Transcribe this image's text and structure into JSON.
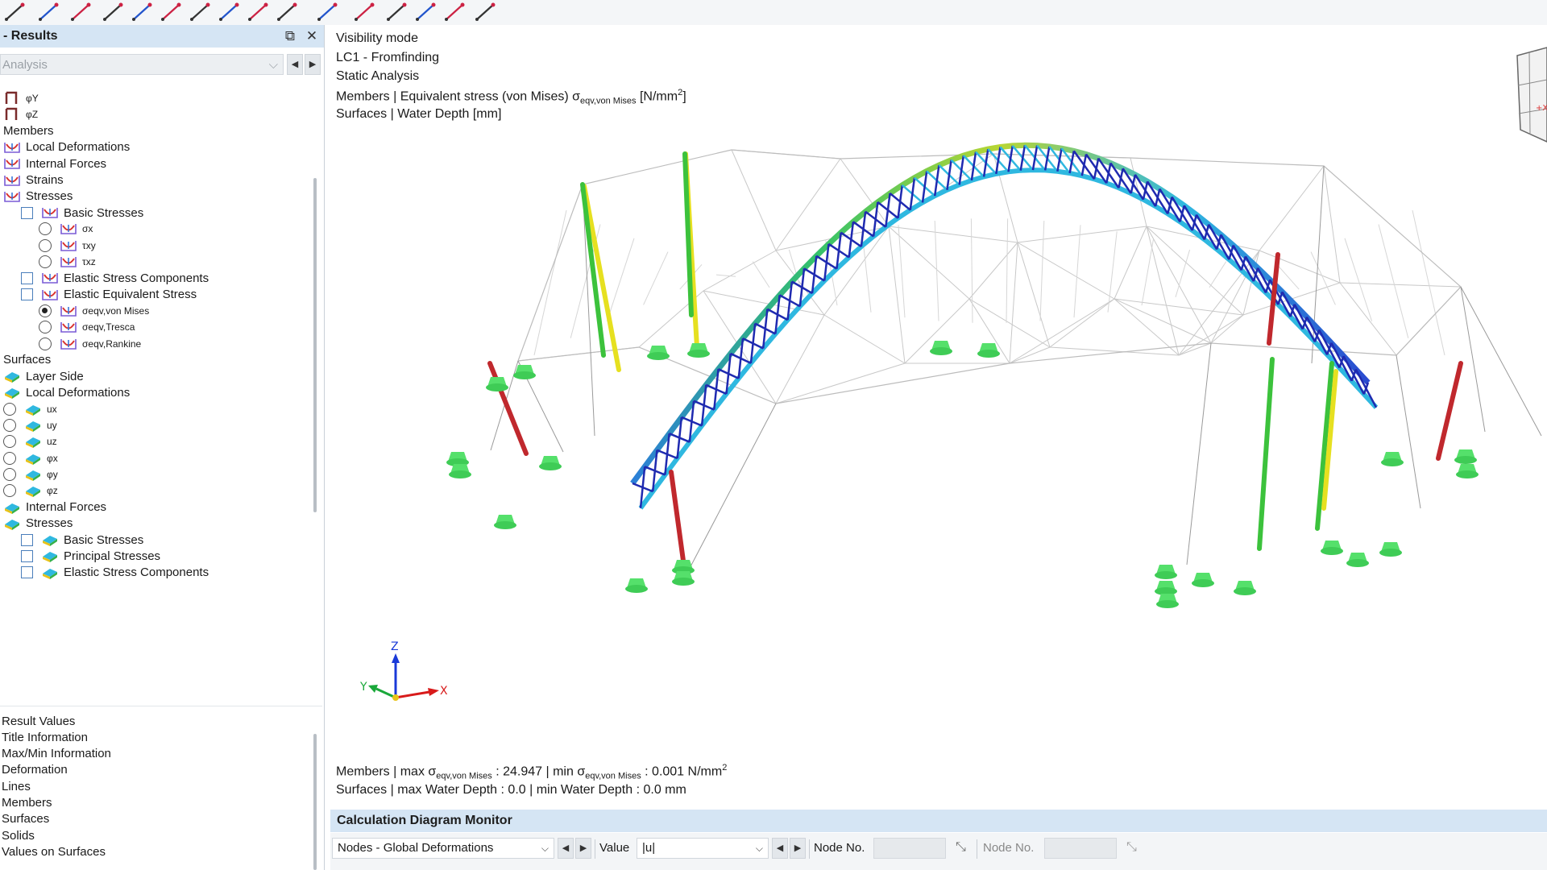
{
  "panel": {
    "title": "- Results",
    "analysis_placeholder": "Analysis",
    "tree": [
      {
        "label": "φY",
        "sub": true,
        "indent": 0,
        "ctrl": "none",
        "icon": "member-rotation-icon"
      },
      {
        "label": "φZ",
        "sub": true,
        "indent": 0,
        "ctrl": "none",
        "icon": "member-rotation-icon"
      },
      {
        "label": "Members",
        "indent": 0,
        "ctrl": "none",
        "icon": "none"
      },
      {
        "label": "Local Deformations",
        "indent": 0,
        "ctrl": "none",
        "icon": "member-result-icon"
      },
      {
        "label": "Internal Forces",
        "indent": 0,
        "ctrl": "none",
        "icon": "member-result-icon"
      },
      {
        "label": "Strains",
        "indent": 0,
        "ctrl": "none",
        "icon": "member-result-icon"
      },
      {
        "label": "Stresses",
        "indent": 0,
        "ctrl": "none",
        "icon": "member-result-icon"
      },
      {
        "label": "Basic Stresses",
        "indent": 1,
        "ctrl": "checkbox",
        "icon": "member-result-icon"
      },
      {
        "label": "σx",
        "sub": true,
        "indent": 2,
        "ctrl": "radio",
        "icon": "member-result-icon"
      },
      {
        "label": "τxy",
        "sub": true,
        "indent": 2,
        "ctrl": "radio",
        "icon": "member-result-icon"
      },
      {
        "label": "τxz",
        "sub": true,
        "indent": 2,
        "ctrl": "radio",
        "icon": "member-result-icon"
      },
      {
        "label": "Elastic Stress Components",
        "indent": 1,
        "ctrl": "checkbox",
        "icon": "member-result-icon"
      },
      {
        "label": "Elastic Equivalent Stress",
        "indent": 1,
        "ctrl": "checkbox",
        "icon": "member-result-icon"
      },
      {
        "label": "σeqv,von Mises",
        "sub": true,
        "indent": 2,
        "ctrl": "radio-on",
        "icon": "member-result-icon"
      },
      {
        "label": "σeqv,Tresca",
        "sub": true,
        "indent": 2,
        "ctrl": "radio",
        "icon": "member-result-icon"
      },
      {
        "label": "σeqv,Rankine",
        "sub": true,
        "indent": 2,
        "ctrl": "radio",
        "icon": "member-result-icon"
      },
      {
        "label": "Surfaces",
        "indent": 0,
        "ctrl": "none",
        "icon": "none"
      },
      {
        "label": "Layer Side",
        "indent": 0,
        "ctrl": "none",
        "icon": "surface-result-icon"
      },
      {
        "label": "Local Deformations",
        "indent": 0,
        "ctrl": "none",
        "icon": "surface-result-icon"
      },
      {
        "label": "ux",
        "sub": true,
        "indent": 0,
        "ctrl": "radio",
        "icon": "surface-result-icon"
      },
      {
        "label": "uy",
        "sub": true,
        "indent": 0,
        "ctrl": "radio",
        "icon": "surface-result-icon"
      },
      {
        "label": "uz",
        "sub": true,
        "indent": 0,
        "ctrl": "radio",
        "icon": "surface-result-icon"
      },
      {
        "label": "φx",
        "sub": true,
        "indent": 0,
        "ctrl": "radio",
        "icon": "surface-result-icon"
      },
      {
        "label": "φy",
        "sub": true,
        "indent": 0,
        "ctrl": "radio",
        "icon": "surface-result-icon"
      },
      {
        "label": "φz",
        "sub": true,
        "indent": 0,
        "ctrl": "radio",
        "icon": "surface-result-icon"
      },
      {
        "label": "Internal Forces",
        "indent": 0,
        "ctrl": "none",
        "icon": "surface-result-icon"
      },
      {
        "label": "Stresses",
        "indent": 0,
        "ctrl": "none",
        "icon": "surface-result-icon"
      },
      {
        "label": "Basic Stresses",
        "indent": 1,
        "ctrl": "checkbox",
        "icon": "surface-result-icon"
      },
      {
        "label": "Principal Stresses",
        "indent": 1,
        "ctrl": "checkbox",
        "icon": "surface-result-icon"
      },
      {
        "label": "Elastic Stress Components",
        "indent": 1,
        "ctrl": "checkbox",
        "icon": "surface-result-icon"
      }
    ],
    "bottom_list": [
      "Result Values",
      "Title Information",
      "Max/Min Information",
      "Deformation",
      "Lines",
      "Members",
      "Surfaces",
      "Solids",
      "Values on Surfaces"
    ]
  },
  "viewport": {
    "info": {
      "mode": "Visibility mode",
      "load_case": "LC1 - Fromfinding",
      "analysis": "Static Analysis",
      "members_prefix": "Members | Equivalent stress (von Mises) σ",
      "members_sub": "eqv,von Mises",
      "members_unit": " [N/mm",
      "members_unit_sup": "2",
      "members_unit_end": "]",
      "surfaces": "Surfaces | Water Depth  [mm]"
    },
    "summary": {
      "members_a": "Members | max σ",
      "members_sub1": "eqv,von Mises",
      "members_b": " : 24.947 | min σ",
      "members_sub2": "eqv,von Mises",
      "members_c": " : 0.001 N/mm",
      "members_sup": "2",
      "surfaces": "Surfaces | max Water Depth : 0.0 | min Water Depth : 0.0 mm"
    },
    "axes": {
      "x": "X",
      "y": "Y",
      "z": "Z"
    },
    "colors": {
      "arch_dark": "#1f2ab0",
      "arch_light": "#2fb8e0",
      "column_green": "#3cc23c",
      "column_yellow": "#e6e020",
      "column_red": "#c0282d",
      "support": "#55e06b"
    }
  },
  "monitor": {
    "title": "Calculation Diagram Monitor",
    "diagram_select": "Nodes - Global Deformations",
    "value_label": "Value",
    "value_select": "|u|",
    "node_label_1": "Node No.",
    "node_label_2": "Node No."
  }
}
